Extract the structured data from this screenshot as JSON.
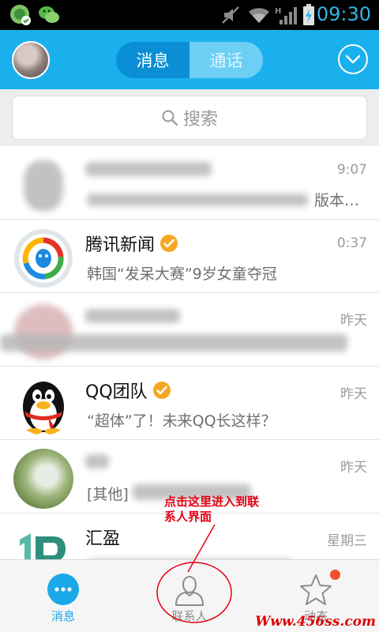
{
  "status_bar": {
    "time": "09:30",
    "icons": [
      "app-notification-icon",
      "wechat-icon",
      "mute-icon",
      "wifi-icon",
      "signal-icon",
      "battery-charging-icon"
    ],
    "time_color": "#33b5e5"
  },
  "header": {
    "tabs": [
      {
        "label": "消息",
        "selected": true
      },
      {
        "label": "通话",
        "selected": false
      }
    ],
    "accent_color": "#1ab0ee"
  },
  "search": {
    "placeholder": "搜索"
  },
  "messages": [
    {
      "name": "",
      "time": "9:07",
      "preview": "版本…",
      "blurred": true,
      "avatar": "blurred-avatar"
    },
    {
      "name": "腾讯新闻",
      "verified": true,
      "time": "0:37",
      "preview": "韩国“发呆大赛”9岁女童夺冠",
      "blurred": false,
      "avatar": "tencent-news-logo"
    },
    {
      "name": "",
      "time": "昨天",
      "preview": "",
      "blurred": true,
      "avatar": "blurred-avatar"
    },
    {
      "name": "QQ团队",
      "verified": true,
      "time": "昨天",
      "preview": "“超体”了！未来QQ长这样？",
      "blurred": false,
      "avatar": "qq-penguin-logo"
    },
    {
      "name": "",
      "time": "昨天",
      "preview": "[其他]",
      "blurred": true,
      "avatar": "blurred-photo-avatar"
    },
    {
      "name": "汇盈",
      "verified": false,
      "time": "星期三",
      "preview": "",
      "blurred": true,
      "avatar": "huiying-logo"
    }
  ],
  "annotation": {
    "line1": "点击这里进入到联",
    "line2": "系人界面",
    "color": "#e60012"
  },
  "tab_bar": {
    "tabs": [
      {
        "label": "消息",
        "icon": "chat-bubble-icon",
        "selected": true
      },
      {
        "label": "联系人",
        "icon": "contacts-icon",
        "selected": false
      },
      {
        "label": "动态",
        "icon": "star-icon",
        "selected": false,
        "has_badge": true
      }
    ]
  },
  "watermark": "Www.456ss.com"
}
